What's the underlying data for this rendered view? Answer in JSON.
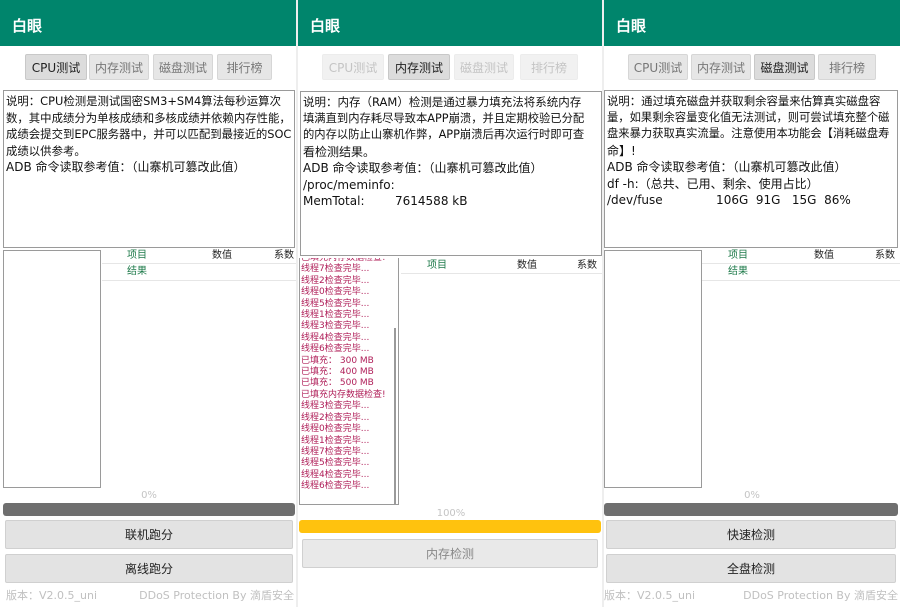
{
  "app_title": "白眼",
  "tabs": [
    "CPU测试",
    "内存测试",
    "磁盘测试",
    "排行榜"
  ],
  "table_headers": {
    "item": "项目",
    "value": "数值",
    "factor": "系数"
  },
  "result_label": "结果",
  "footer": {
    "version": "版本：V2.0.5_uni",
    "ddos": "DDoS Protection By 滴盾安全"
  },
  "cpu": {
    "desc_lines": [
      "说明：CPU检测是测试国密SM3+SM4算法每秒运算次",
      "数，其中成绩分为单核成绩和多核成绩并依赖内存性能，",
      "成绩会提交到EPC服务器中，并可以匹配到最接近的SOC",
      "成绩以供参考。",
      "ADB 命令读取参考值：（山寨机可篡改此值）"
    ],
    "progress": "0%",
    "progress_fraction": 0,
    "buttons": [
      "联机跑分",
      "离线跑分"
    ]
  },
  "memory": {
    "desc_lines": [
      "说明：内存（RAM）检测是通过暴力填充法将系统内存",
      "填满直到内存耗尽导致本APP崩溃，并且定期校验已分配",
      "的内存以防止山寨机作弊，APP崩溃后再次运行时即可查",
      "看检测结果。",
      "ADB 命令读取参考值：（山寨机可篡改此值）",
      "/proc/meminfo:",
      "MemTotal:        7614588 kB"
    ],
    "log_lines": [
      "已填充内存数据检查!",
      "线程7检查完毕...",
      "线程2检查完毕...",
      "线程0检查完毕...",
      "线程5检查完毕...",
      "线程1检查完毕...",
      "线程3检查完毕...",
      "线程4检查完毕...",
      "线程6检查完毕...",
      "已填充： 300 MB",
      "已填充： 400 MB",
      "已填充： 500 MB",
      "已填充内存数据检查!",
      "线程3检查完毕...",
      "线程2检查完毕...",
      "线程0检查完毕...",
      "线程1检查完毕...",
      "线程7检查完毕...",
      "线程5检查完毕...",
      "线程4检查完毕...",
      "线程6检查完毕..."
    ],
    "progress": "100%",
    "progress_fraction": 1,
    "button": "内存检测"
  },
  "disk": {
    "desc_lines": [
      "说明：通过填充磁盘并获取剩余容量来估算真实磁盘容",
      "量，如果剩余容量变化值无法测试，则可尝试填充整个磁",
      "盘来暴力获取真实流量。注意使用本功能会【消耗磁盘寿",
      "命】!",
      "ADB 命令读取参考值：（山寨机可篡改此值）",
      "df -h:（总共、已用、剩余、使用占比）",
      "/dev/fuse              106G  91G   15G  86%"
    ],
    "progress": "0%",
    "progress_fraction": 0,
    "buttons": [
      "快速检测",
      "全盘检测"
    ]
  },
  "colors": {
    "appbar": "#00856c",
    "progress_done": "#ffc20e",
    "progress_track": "#6f6f6f",
    "log_text": "#b0205a"
  }
}
